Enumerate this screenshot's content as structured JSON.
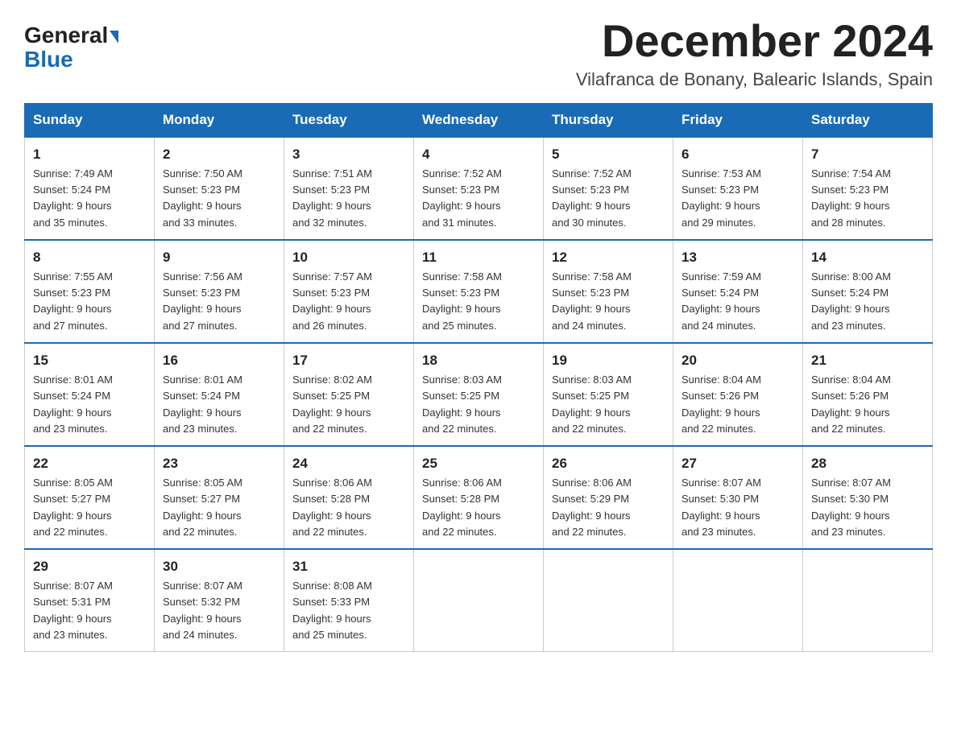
{
  "header": {
    "logo_general": "General",
    "logo_blue": "Blue",
    "month_title": "December 2024",
    "location": "Vilafranca de Bonany, Balearic Islands, Spain"
  },
  "days_of_week": [
    "Sunday",
    "Monday",
    "Tuesday",
    "Wednesday",
    "Thursday",
    "Friday",
    "Saturday"
  ],
  "weeks": [
    [
      {
        "day": "1",
        "sunrise": "7:49 AM",
        "sunset": "5:24 PM",
        "daylight": "9 hours and 35 minutes."
      },
      {
        "day": "2",
        "sunrise": "7:50 AM",
        "sunset": "5:23 PM",
        "daylight": "9 hours and 33 minutes."
      },
      {
        "day": "3",
        "sunrise": "7:51 AM",
        "sunset": "5:23 PM",
        "daylight": "9 hours and 32 minutes."
      },
      {
        "day": "4",
        "sunrise": "7:52 AM",
        "sunset": "5:23 PM",
        "daylight": "9 hours and 31 minutes."
      },
      {
        "day": "5",
        "sunrise": "7:52 AM",
        "sunset": "5:23 PM",
        "daylight": "9 hours and 30 minutes."
      },
      {
        "day": "6",
        "sunrise": "7:53 AM",
        "sunset": "5:23 PM",
        "daylight": "9 hours and 29 minutes."
      },
      {
        "day": "7",
        "sunrise": "7:54 AM",
        "sunset": "5:23 PM",
        "daylight": "9 hours and 28 minutes."
      }
    ],
    [
      {
        "day": "8",
        "sunrise": "7:55 AM",
        "sunset": "5:23 PM",
        "daylight": "9 hours and 27 minutes."
      },
      {
        "day": "9",
        "sunrise": "7:56 AM",
        "sunset": "5:23 PM",
        "daylight": "9 hours and 27 minutes."
      },
      {
        "day": "10",
        "sunrise": "7:57 AM",
        "sunset": "5:23 PM",
        "daylight": "9 hours and 26 minutes."
      },
      {
        "day": "11",
        "sunrise": "7:58 AM",
        "sunset": "5:23 PM",
        "daylight": "9 hours and 25 minutes."
      },
      {
        "day": "12",
        "sunrise": "7:58 AM",
        "sunset": "5:23 PM",
        "daylight": "9 hours and 24 minutes."
      },
      {
        "day": "13",
        "sunrise": "7:59 AM",
        "sunset": "5:24 PM",
        "daylight": "9 hours and 24 minutes."
      },
      {
        "day": "14",
        "sunrise": "8:00 AM",
        "sunset": "5:24 PM",
        "daylight": "9 hours and 23 minutes."
      }
    ],
    [
      {
        "day": "15",
        "sunrise": "8:01 AM",
        "sunset": "5:24 PM",
        "daylight": "9 hours and 23 minutes."
      },
      {
        "day": "16",
        "sunrise": "8:01 AM",
        "sunset": "5:24 PM",
        "daylight": "9 hours and 23 minutes."
      },
      {
        "day": "17",
        "sunrise": "8:02 AM",
        "sunset": "5:25 PM",
        "daylight": "9 hours and 22 minutes."
      },
      {
        "day": "18",
        "sunrise": "8:03 AM",
        "sunset": "5:25 PM",
        "daylight": "9 hours and 22 minutes."
      },
      {
        "day": "19",
        "sunrise": "8:03 AM",
        "sunset": "5:25 PM",
        "daylight": "9 hours and 22 minutes."
      },
      {
        "day": "20",
        "sunrise": "8:04 AM",
        "sunset": "5:26 PM",
        "daylight": "9 hours and 22 minutes."
      },
      {
        "day": "21",
        "sunrise": "8:04 AM",
        "sunset": "5:26 PM",
        "daylight": "9 hours and 22 minutes."
      }
    ],
    [
      {
        "day": "22",
        "sunrise": "8:05 AM",
        "sunset": "5:27 PM",
        "daylight": "9 hours and 22 minutes."
      },
      {
        "day": "23",
        "sunrise": "8:05 AM",
        "sunset": "5:27 PM",
        "daylight": "9 hours and 22 minutes."
      },
      {
        "day": "24",
        "sunrise": "8:06 AM",
        "sunset": "5:28 PM",
        "daylight": "9 hours and 22 minutes."
      },
      {
        "day": "25",
        "sunrise": "8:06 AM",
        "sunset": "5:28 PM",
        "daylight": "9 hours and 22 minutes."
      },
      {
        "day": "26",
        "sunrise": "8:06 AM",
        "sunset": "5:29 PM",
        "daylight": "9 hours and 22 minutes."
      },
      {
        "day": "27",
        "sunrise": "8:07 AM",
        "sunset": "5:30 PM",
        "daylight": "9 hours and 23 minutes."
      },
      {
        "day": "28",
        "sunrise": "8:07 AM",
        "sunset": "5:30 PM",
        "daylight": "9 hours and 23 minutes."
      }
    ],
    [
      {
        "day": "29",
        "sunrise": "8:07 AM",
        "sunset": "5:31 PM",
        "daylight": "9 hours and 23 minutes."
      },
      {
        "day": "30",
        "sunrise": "8:07 AM",
        "sunset": "5:32 PM",
        "daylight": "9 hours and 24 minutes."
      },
      {
        "day": "31",
        "sunrise": "8:08 AM",
        "sunset": "5:33 PM",
        "daylight": "9 hours and 25 minutes."
      },
      null,
      null,
      null,
      null
    ]
  ]
}
